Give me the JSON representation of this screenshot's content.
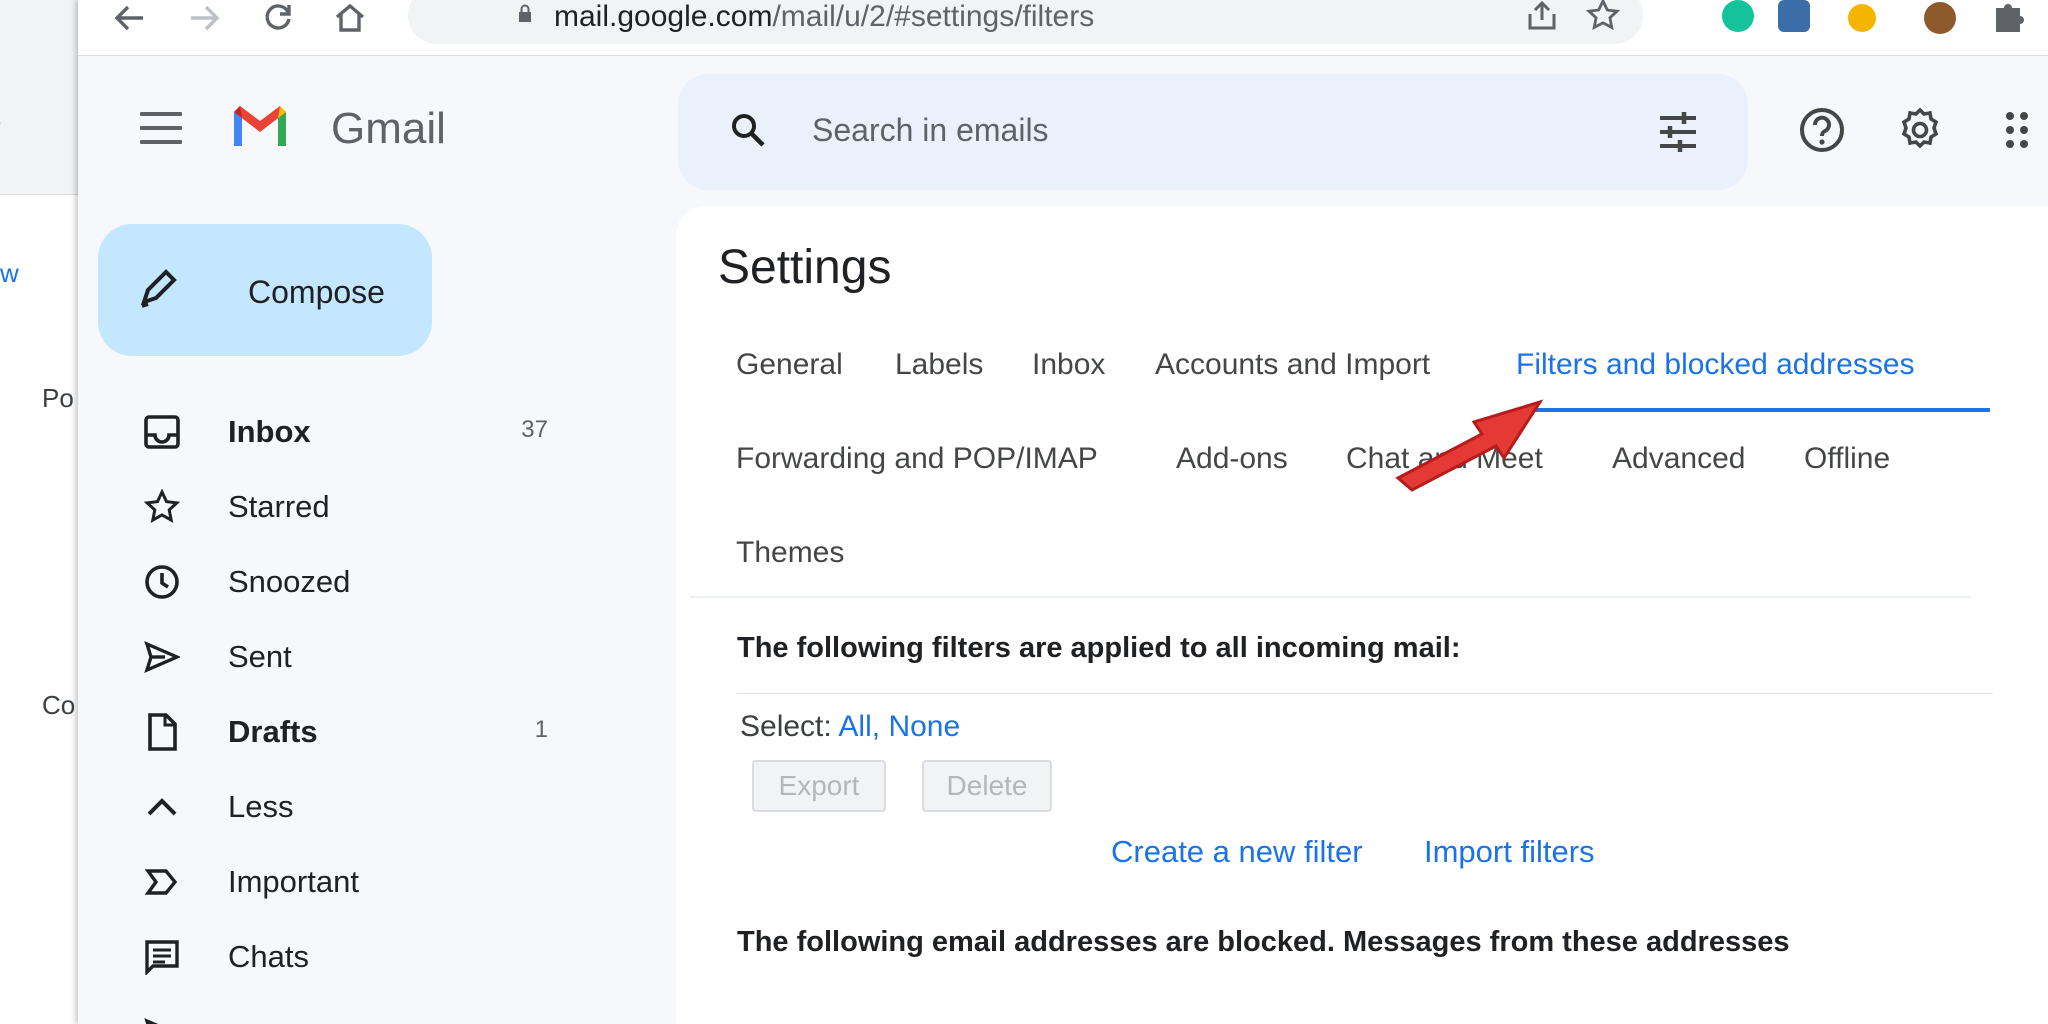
{
  "background_window": {
    "frag_w": "w",
    "frag_po": "Po",
    "frag_co": "Co"
  },
  "browser": {
    "url_host": "mail.google.com",
    "url_path": "/mail/u/2/#settings/filters"
  },
  "header": {
    "app_name": "Gmail",
    "search_placeholder": "Search in emails"
  },
  "sidebar": {
    "compose_label": "Compose",
    "items": [
      {
        "label": "Inbox",
        "count": "37",
        "bold": true,
        "icon": "inbox-icon"
      },
      {
        "label": "Starred",
        "count": "",
        "bold": false,
        "icon": "star-icon"
      },
      {
        "label": "Snoozed",
        "count": "",
        "bold": false,
        "icon": "clock-icon"
      },
      {
        "label": "Sent",
        "count": "",
        "bold": false,
        "icon": "send-icon"
      },
      {
        "label": "Drafts",
        "count": "1",
        "bold": true,
        "icon": "draft-icon"
      },
      {
        "label": "Less",
        "count": "",
        "bold": false,
        "icon": "chevron-up-icon"
      },
      {
        "label": "Important",
        "count": "",
        "bold": false,
        "icon": "important-icon"
      },
      {
        "label": "Chats",
        "count": "",
        "bold": false,
        "icon": "chat-icon"
      }
    ]
  },
  "settings": {
    "title": "Settings",
    "tabs_row1": [
      "General",
      "Labels",
      "Inbox",
      "Accounts and Import",
      "Filters and blocked addresses"
    ],
    "tabs_row2": [
      "Forwarding and POP/IMAP",
      "Add-ons",
      "Chat and Meet",
      "Advanced",
      "Offline"
    ],
    "tabs_row3": [
      "Themes"
    ],
    "active_tab": "Filters and blocked addresses",
    "filters_heading": "The following filters are applied to all incoming mail:",
    "select_label": "Select:",
    "select_all": "All,",
    "select_none": "None",
    "export_button": "Export",
    "delete_button": "Delete",
    "create_filter_link": "Create a new filter",
    "import_filters_link": "Import filters",
    "blocked_heading": "The following email addresses are blocked. Messages from these addresses"
  },
  "colors": {
    "accent": "#1a73e8",
    "compose_bg": "#c2e7ff",
    "search_bg": "#eaf1fb",
    "annotation_arrow": "#e53935"
  }
}
